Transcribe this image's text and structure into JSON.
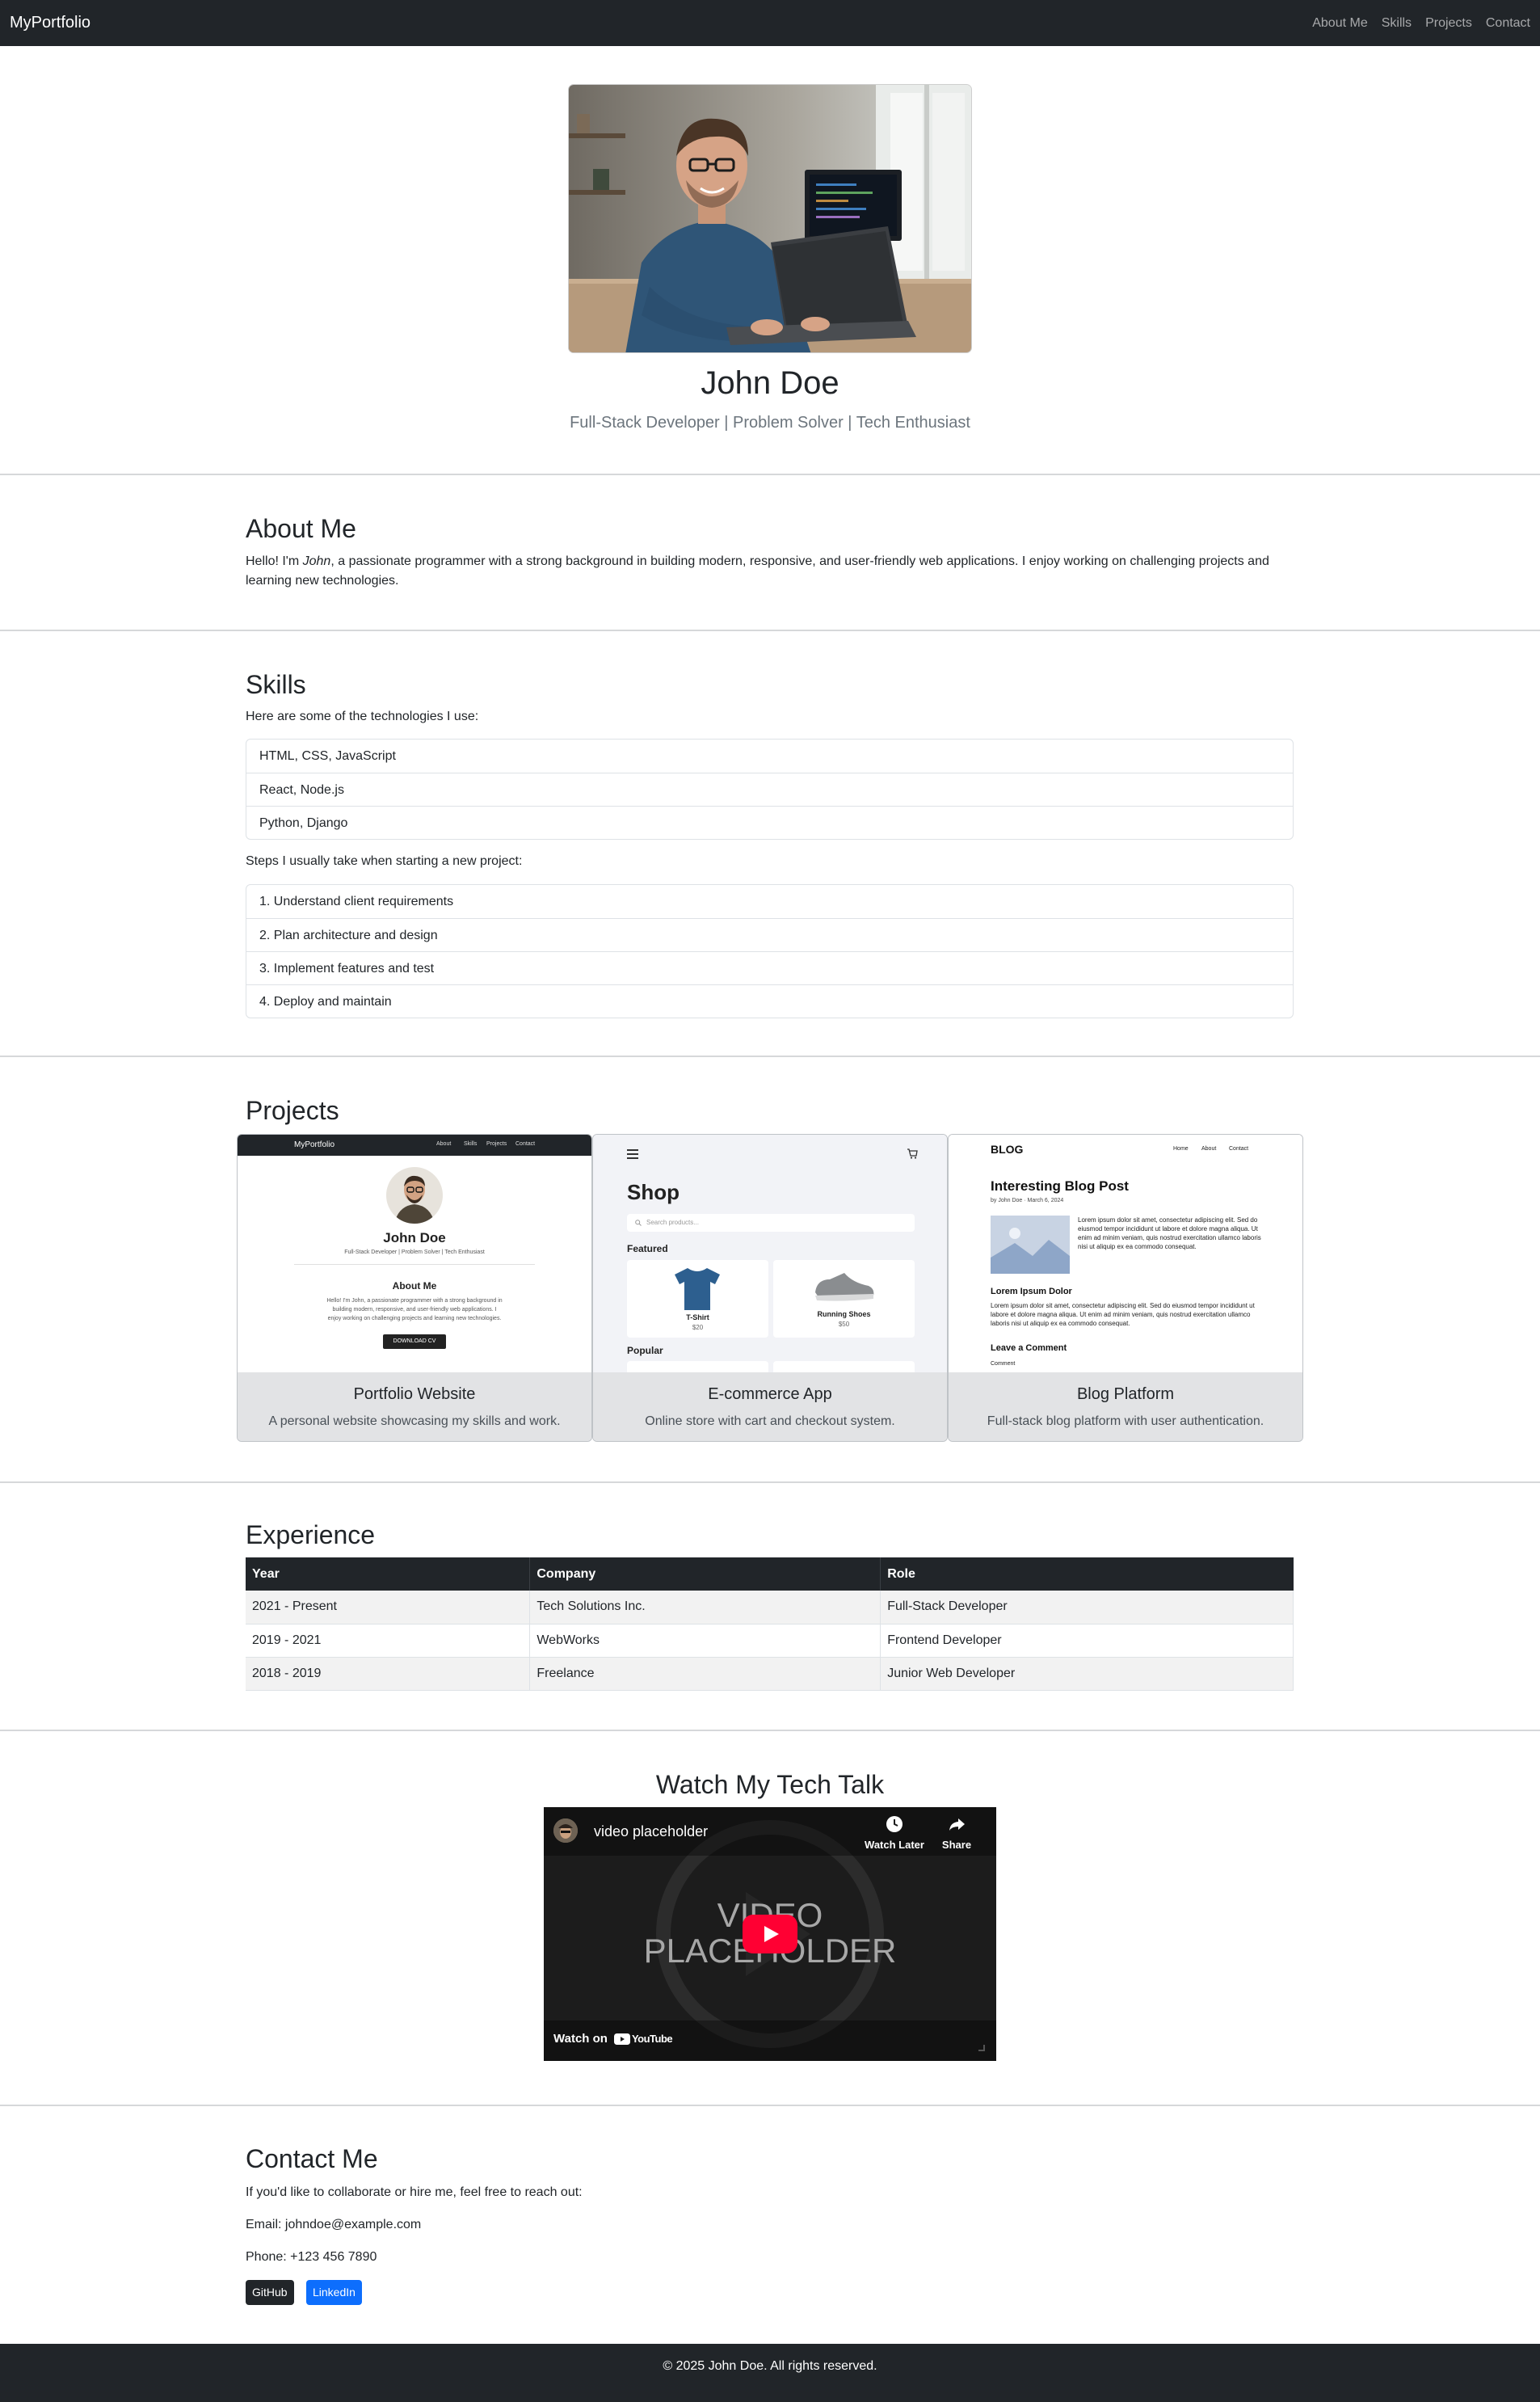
{
  "nav": {
    "brand": "MyPortfolio",
    "links": [
      "About Me",
      "Skills",
      "Projects",
      "Contact"
    ]
  },
  "hero": {
    "name": "John Doe",
    "tagline": "Full-Stack Developer | Problem Solver | Tech Enthusiast"
  },
  "about": {
    "title": "About Me",
    "text_before": "Hello! I'm ",
    "name_em": "John",
    "text_after": ", a passionate programmer with a strong background in building modern, responsive, and user-friendly web applications. I enjoy working on challenging projects and learning new technologies."
  },
  "skills": {
    "title": "Skills",
    "intro": "Here are some of the technologies I use:",
    "items": [
      "HTML, CSS, JavaScript",
      "React, Node.js",
      "Python, Django"
    ],
    "steps_intro": "Steps I usually take when starting a new project:",
    "steps": [
      "1. Understand client requirements",
      "2. Plan architecture and design",
      "3. Implement features and test",
      "4. Deploy and maintain"
    ]
  },
  "projects": {
    "title": "Projects",
    "cards": [
      {
        "title": "Portfolio Website",
        "text": "A personal website showcasing my skills and work.",
        "preview": {
          "brand": "MyPortfolio",
          "links": [
            "About",
            "Skills",
            "Projects",
            "Contact"
          ],
          "name": "John Doe",
          "tagline": "Full-Stack Developer | Problem Solver | Tech Enthusiast",
          "section": "About Me",
          "line1": "Hello! I'm John, a passionate programmer with a strong background in",
          "line2": "building modern, responsive, and user-friendly web applications. I",
          "line3": "enjoy working on challenging projects and learning new technologies.",
          "button": "DOWNLOAD CV"
        }
      },
      {
        "title": "E-commerce App",
        "text": "Online store with cart and checkout system.",
        "preview": {
          "heading": "Shop",
          "search_placeholder": "Search products...",
          "featured": "Featured",
          "item1_name": "T-Shirt",
          "item1_price": "$20",
          "item2_name": "Running Shoes",
          "item2_price": "$50",
          "popular": "Popular"
        }
      },
      {
        "title": "Blog Platform",
        "text": "Full-stack blog platform with user authentication.",
        "preview": {
          "logo": "BLOG",
          "links": [
            "Home",
            "About",
            "Contact"
          ],
          "post_title": "Interesting Blog Post",
          "byline": "by John Doe · March 6, 2024",
          "lorem1": "Lorem ipsum dolor sit amet, consectetur adipiscing elit. Sed do eiusmod tempor incididunt ut labore et dolore magna aliqua. Ut enim ad minim veniam, quis nostrud exercitation ullamco laboris nisi ut aliquip ex ea commodo consequat.",
          "subheading": "Lorem Ipsum Dolor",
          "lorem2": "Lorem ipsum dolor sit amet, consectetur adipiscing elit. Sed do eiusmod tempor incididunt ut labore et dolore magna aliqua. Ut enim ad minim veniam, quis nostrud exercitation ullamco laboris nisi ut aliquip ex ea commodo consequat.",
          "comment_heading": "Leave a Comment",
          "comment_label": "Comment"
        }
      }
    ]
  },
  "experience": {
    "title": "Experience",
    "headers": [
      "Year",
      "Company",
      "Role"
    ],
    "rows": [
      [
        "2021 - Present",
        "Tech Solutions Inc.",
        "Full-Stack Developer"
      ],
      [
        "2019 - 2021",
        "WebWorks",
        "Frontend Developer"
      ],
      [
        "2018 - 2019",
        "Freelance",
        "Junior Web Developer"
      ]
    ]
  },
  "video": {
    "title": "Watch My Tech Talk",
    "channel_title": "video placeholder",
    "watch_later": "Watch Later",
    "share": "Share",
    "placeholder_line1": "VIDEO",
    "placeholder_line2": "PLACEHOLDER",
    "watch_on": "Watch on",
    "youtube": "YouTube"
  },
  "contact": {
    "title": "Contact Me",
    "intro": "If you'd like to collaborate or hire me, feel free to reach out:",
    "email": "Email: johndoe@example.com",
    "phone": "Phone: +123 456 7890",
    "github": "GitHub",
    "linkedin": "LinkedIn"
  },
  "footer": {
    "text": "© 2025 John Doe. All rights reserved."
  },
  "colors": {
    "dark": "#212529",
    "primary": "#0d6efd",
    "muted": "#6c757d",
    "card_body": "#e2e3e5",
    "youtube_red": "#ff0033"
  }
}
